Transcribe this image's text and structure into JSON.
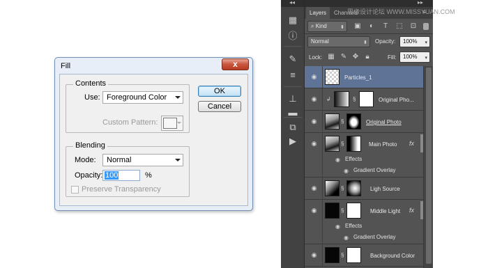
{
  "watermark": "思缘设计论坛 WWW.MISSYUAN.COM",
  "fill_dialog": {
    "title": "Fill",
    "close_glyph": "x",
    "contents_group": "Contents",
    "use_label": "Use:",
    "use_value": "Foreground Color",
    "custom_pattern_label": "Custom Pattern:",
    "blending_group": "Blending",
    "mode_label": "Mode:",
    "mode_value": "Normal",
    "opacity_label": "Opacity:",
    "opacity_value": "100",
    "opacity_unit": "%",
    "preserve_label": "Preserve Transparency",
    "preserve_checked": false,
    "ok_label": "OK",
    "cancel_label": "Cancel"
  },
  "layers_panel": {
    "tabs": [
      "Layers",
      "Channels"
    ],
    "kind_label": "Kind",
    "blend_mode": "Normal",
    "opacity_label": "Opacity:",
    "opacity_value": "100%",
    "lock_label": "Lock:",
    "fill_label": "Fill:",
    "fill_value": "100%",
    "layers": [
      {
        "name": "Particles_1",
        "selected": true
      },
      {
        "name": "Original Pho..."
      },
      {
        "name": "Original Photo"
      },
      {
        "name": "Main Photo",
        "fx": "fx",
        "effects_label": "Effects",
        "effect": "Gradient Overlay"
      },
      {
        "name": "Ligh Source"
      },
      {
        "name": "Middle Light",
        "fx": "fx",
        "effects_label": "Effects",
        "effect": "Gradient Overlay"
      },
      {
        "name": "Background Color"
      }
    ]
  }
}
